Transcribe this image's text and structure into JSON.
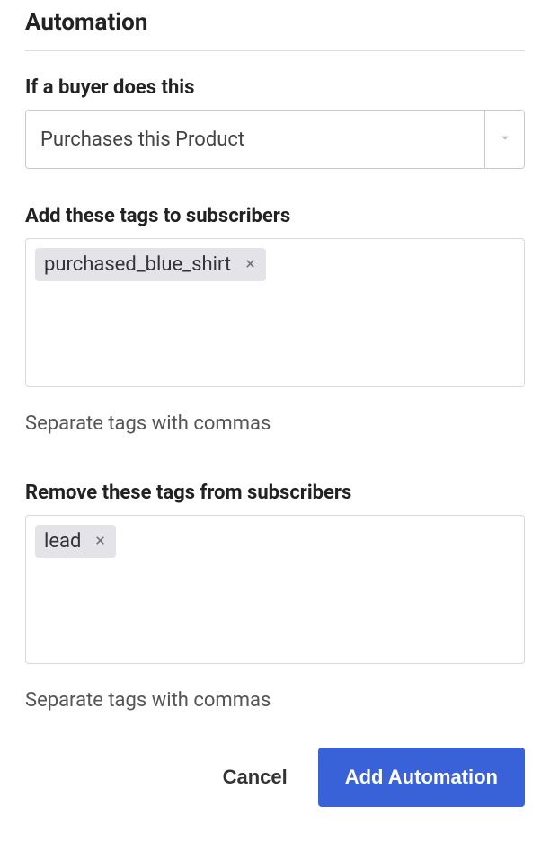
{
  "section_title": "Automation",
  "trigger": {
    "label": "If a buyer does this",
    "selected": "Purchases this Product"
  },
  "add_tags": {
    "label": "Add these tags to subscribers",
    "tags": [
      "purchased_blue_shirt"
    ],
    "hint": "Separate tags with commas"
  },
  "remove_tags": {
    "label": "Remove these tags from subscribers",
    "tags": [
      "lead"
    ],
    "hint": "Separate tags with commas"
  },
  "buttons": {
    "cancel": "Cancel",
    "submit": "Add Automation"
  }
}
